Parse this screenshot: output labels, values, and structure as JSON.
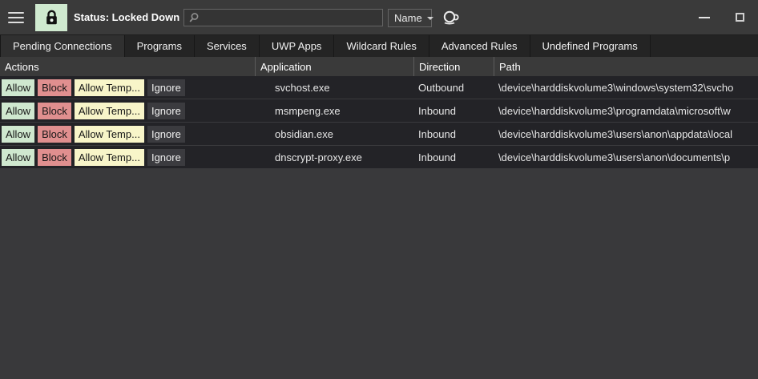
{
  "titlebar": {
    "status": "Status: Locked Down",
    "search_placeholder": "",
    "filter_label": "Name"
  },
  "tabs": [
    {
      "label": "Pending Connections",
      "active": true
    },
    {
      "label": "Programs",
      "active": false
    },
    {
      "label": "Services",
      "active": false
    },
    {
      "label": "UWP Apps",
      "active": false
    },
    {
      "label": "Wildcard Rules",
      "active": false
    },
    {
      "label": "Advanced Rules",
      "active": false
    },
    {
      "label": "Undefined Programs",
      "active": false
    }
  ],
  "table": {
    "columns": {
      "actions": "Actions",
      "application": "Application",
      "direction": "Direction",
      "path": "Path"
    },
    "action_labels": [
      "Allow",
      "Block",
      "Allow Temp...",
      "Ignore"
    ],
    "rows": [
      {
        "application": "svchost.exe",
        "direction": "Outbound",
        "path": "\\device\\harddiskvolume3\\windows\\system32\\svcho"
      },
      {
        "application": "msmpeng.exe",
        "direction": "Inbound",
        "path": "\\device\\harddiskvolume3\\programdata\\microsoft\\w"
      },
      {
        "application": "obsidian.exe",
        "direction": "Inbound",
        "path": "\\device\\harddiskvolume3\\users\\anon\\appdata\\local"
      },
      {
        "application": "dnscrypt-proxy.exe",
        "direction": "Inbound",
        "path": "\\device\\harddiskvolume3\\users\\anon\\documents\\p"
      }
    ]
  },
  "icons": {
    "menu": "hamburger-icon",
    "lock": "lock-icon",
    "search": "search-icon",
    "dropdown": "chevron-down-icon",
    "donate": "coffee-cup-icon",
    "minimize": "minimize-icon",
    "maximize": "maximize-icon"
  },
  "colors": {
    "status_lock_green": "#cfe9cf",
    "allow_green": "#cfe8cf",
    "block_red": "#e08f8f",
    "allow_temp_yellow": "#f8f5c9",
    "titlebar_bg": "#3a3a3a",
    "row_bg": "#232327",
    "empty_bg": "#39393b"
  }
}
